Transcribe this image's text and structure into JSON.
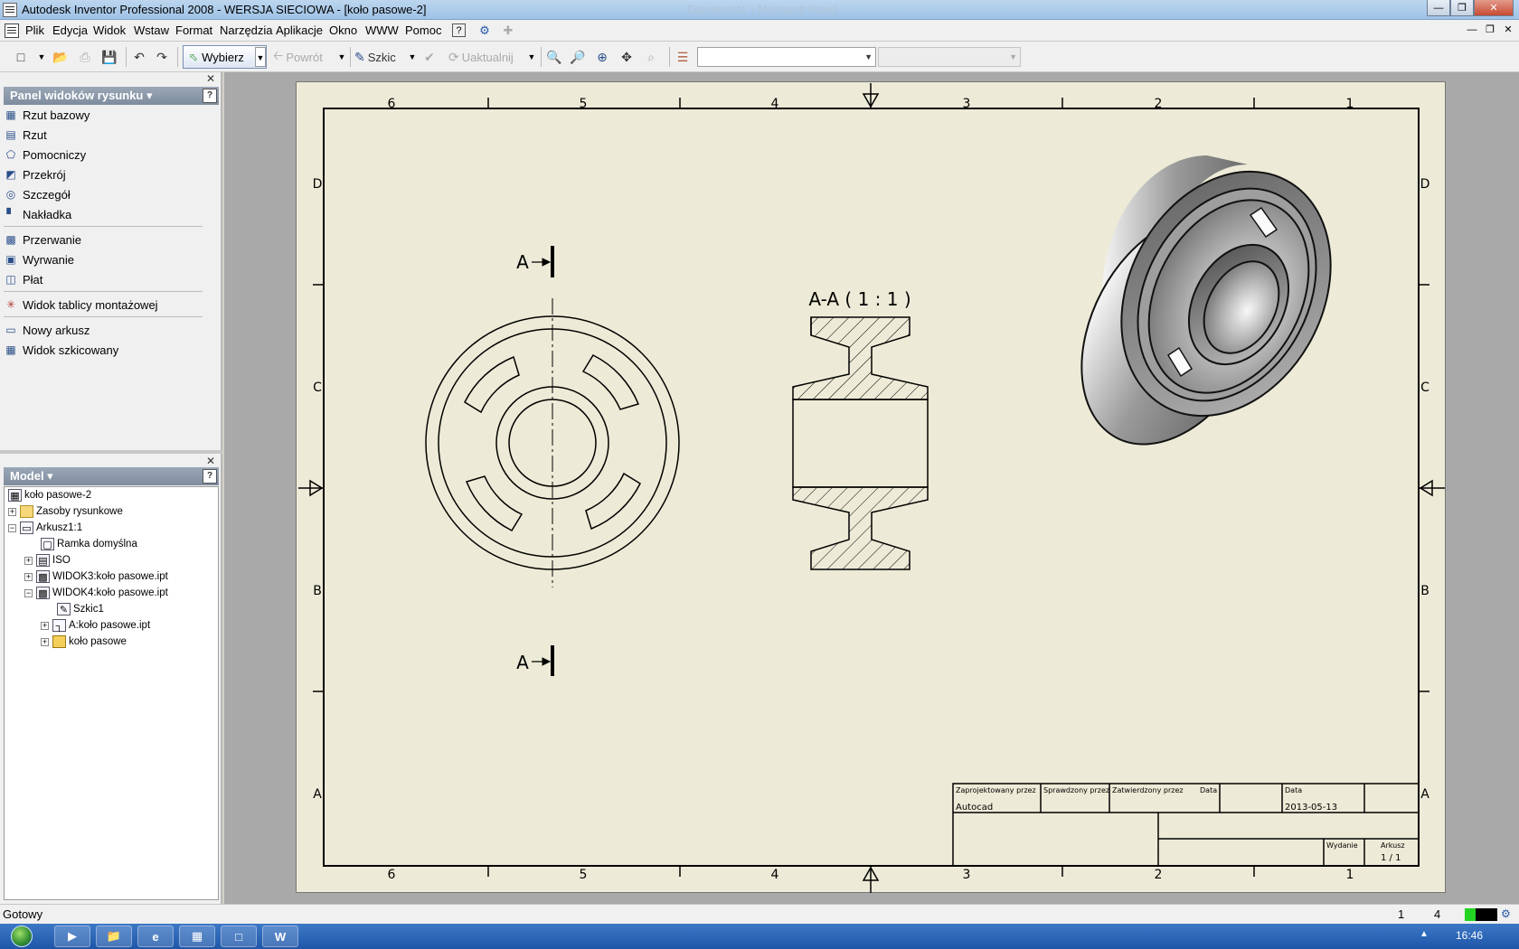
{
  "window": {
    "title": "Autodesk Inventor Professional 2008 - WERSJA SIECIOWA - [koło pasowe-2]",
    "ghost_title": "Dokument1 - Microsoft Word"
  },
  "menu": {
    "items": [
      "Plik",
      "Edycja",
      "Widok",
      "Wstaw",
      "Format",
      "Narzędzia",
      "Aplikacje",
      "Okno",
      "WWW",
      "Pomoc"
    ]
  },
  "toolbar": {
    "select_label": "Wybierz",
    "back_label": "Powrót",
    "sketch_label": "Szkic",
    "update_label": "Uaktualnij"
  },
  "views_panel": {
    "title": "Panel widoków rysunku",
    "items": [
      {
        "label": "Rzut bazowy",
        "icon": "base-view-icon"
      },
      {
        "label": "Rzut",
        "icon": "projected-view-icon"
      },
      {
        "label": "Pomocniczy",
        "icon": "auxiliary-view-icon"
      },
      {
        "label": "Przekrój",
        "icon": "section-view-icon"
      },
      {
        "label": "Szczegół",
        "icon": "detail-view-icon"
      },
      {
        "label": "Nakładka",
        "icon": "overlay-view-icon"
      },
      {
        "label": "Przerwanie",
        "icon": "break-icon"
      },
      {
        "label": "Wyrwanie",
        "icon": "breakout-icon"
      },
      {
        "label": "Płat",
        "icon": "slice-icon"
      },
      {
        "label": "Widok tablicy montażowej",
        "icon": "nailboard-icon"
      },
      {
        "label": "Nowy arkusz",
        "icon": "new-sheet-icon"
      },
      {
        "label": "Widok szkicowany",
        "icon": "draft-view-icon"
      }
    ]
  },
  "model_panel": {
    "title": "Model",
    "tree": [
      {
        "label": "koło pasowe-2"
      },
      {
        "label": "Zasoby rysunkowe"
      },
      {
        "label": "Arkusz1:1"
      },
      {
        "label": "Ramka domyślna"
      },
      {
        "label": "ISO"
      },
      {
        "label": "WIDOK3:koło pasowe.ipt"
      },
      {
        "label": "WIDOK4:koło pasowe.ipt"
      },
      {
        "label": "Szkic1"
      },
      {
        "label": "A:koło pasowe.ipt"
      },
      {
        "label": "koło pasowe"
      }
    ]
  },
  "drawing": {
    "zone_columns": [
      "6",
      "5",
      "4",
      "3",
      "2",
      "1"
    ],
    "zone_rows": [
      "D",
      "C",
      "B",
      "A"
    ],
    "section_letter": "A",
    "section_title": "A-A ( 1 : 1 )",
    "title_block": {
      "designed_by_label": "Zaprojektowany przez",
      "checked_by_label": "Sprawdzony przez",
      "approved_by_label": "Zatwierdzony przez",
      "date_label_1": "Data",
      "date_label_2": "Data",
      "designed_by_value": "Autocad",
      "date_value": "2013-05-13",
      "issue_label": "Wydanie",
      "sheet_label": "Arkusz",
      "sheet_value": "1 / 1"
    }
  },
  "status": {
    "message": "Gotowy",
    "value_1": "1",
    "value_2": "4"
  },
  "taskbar": {
    "clock": "16:46"
  }
}
